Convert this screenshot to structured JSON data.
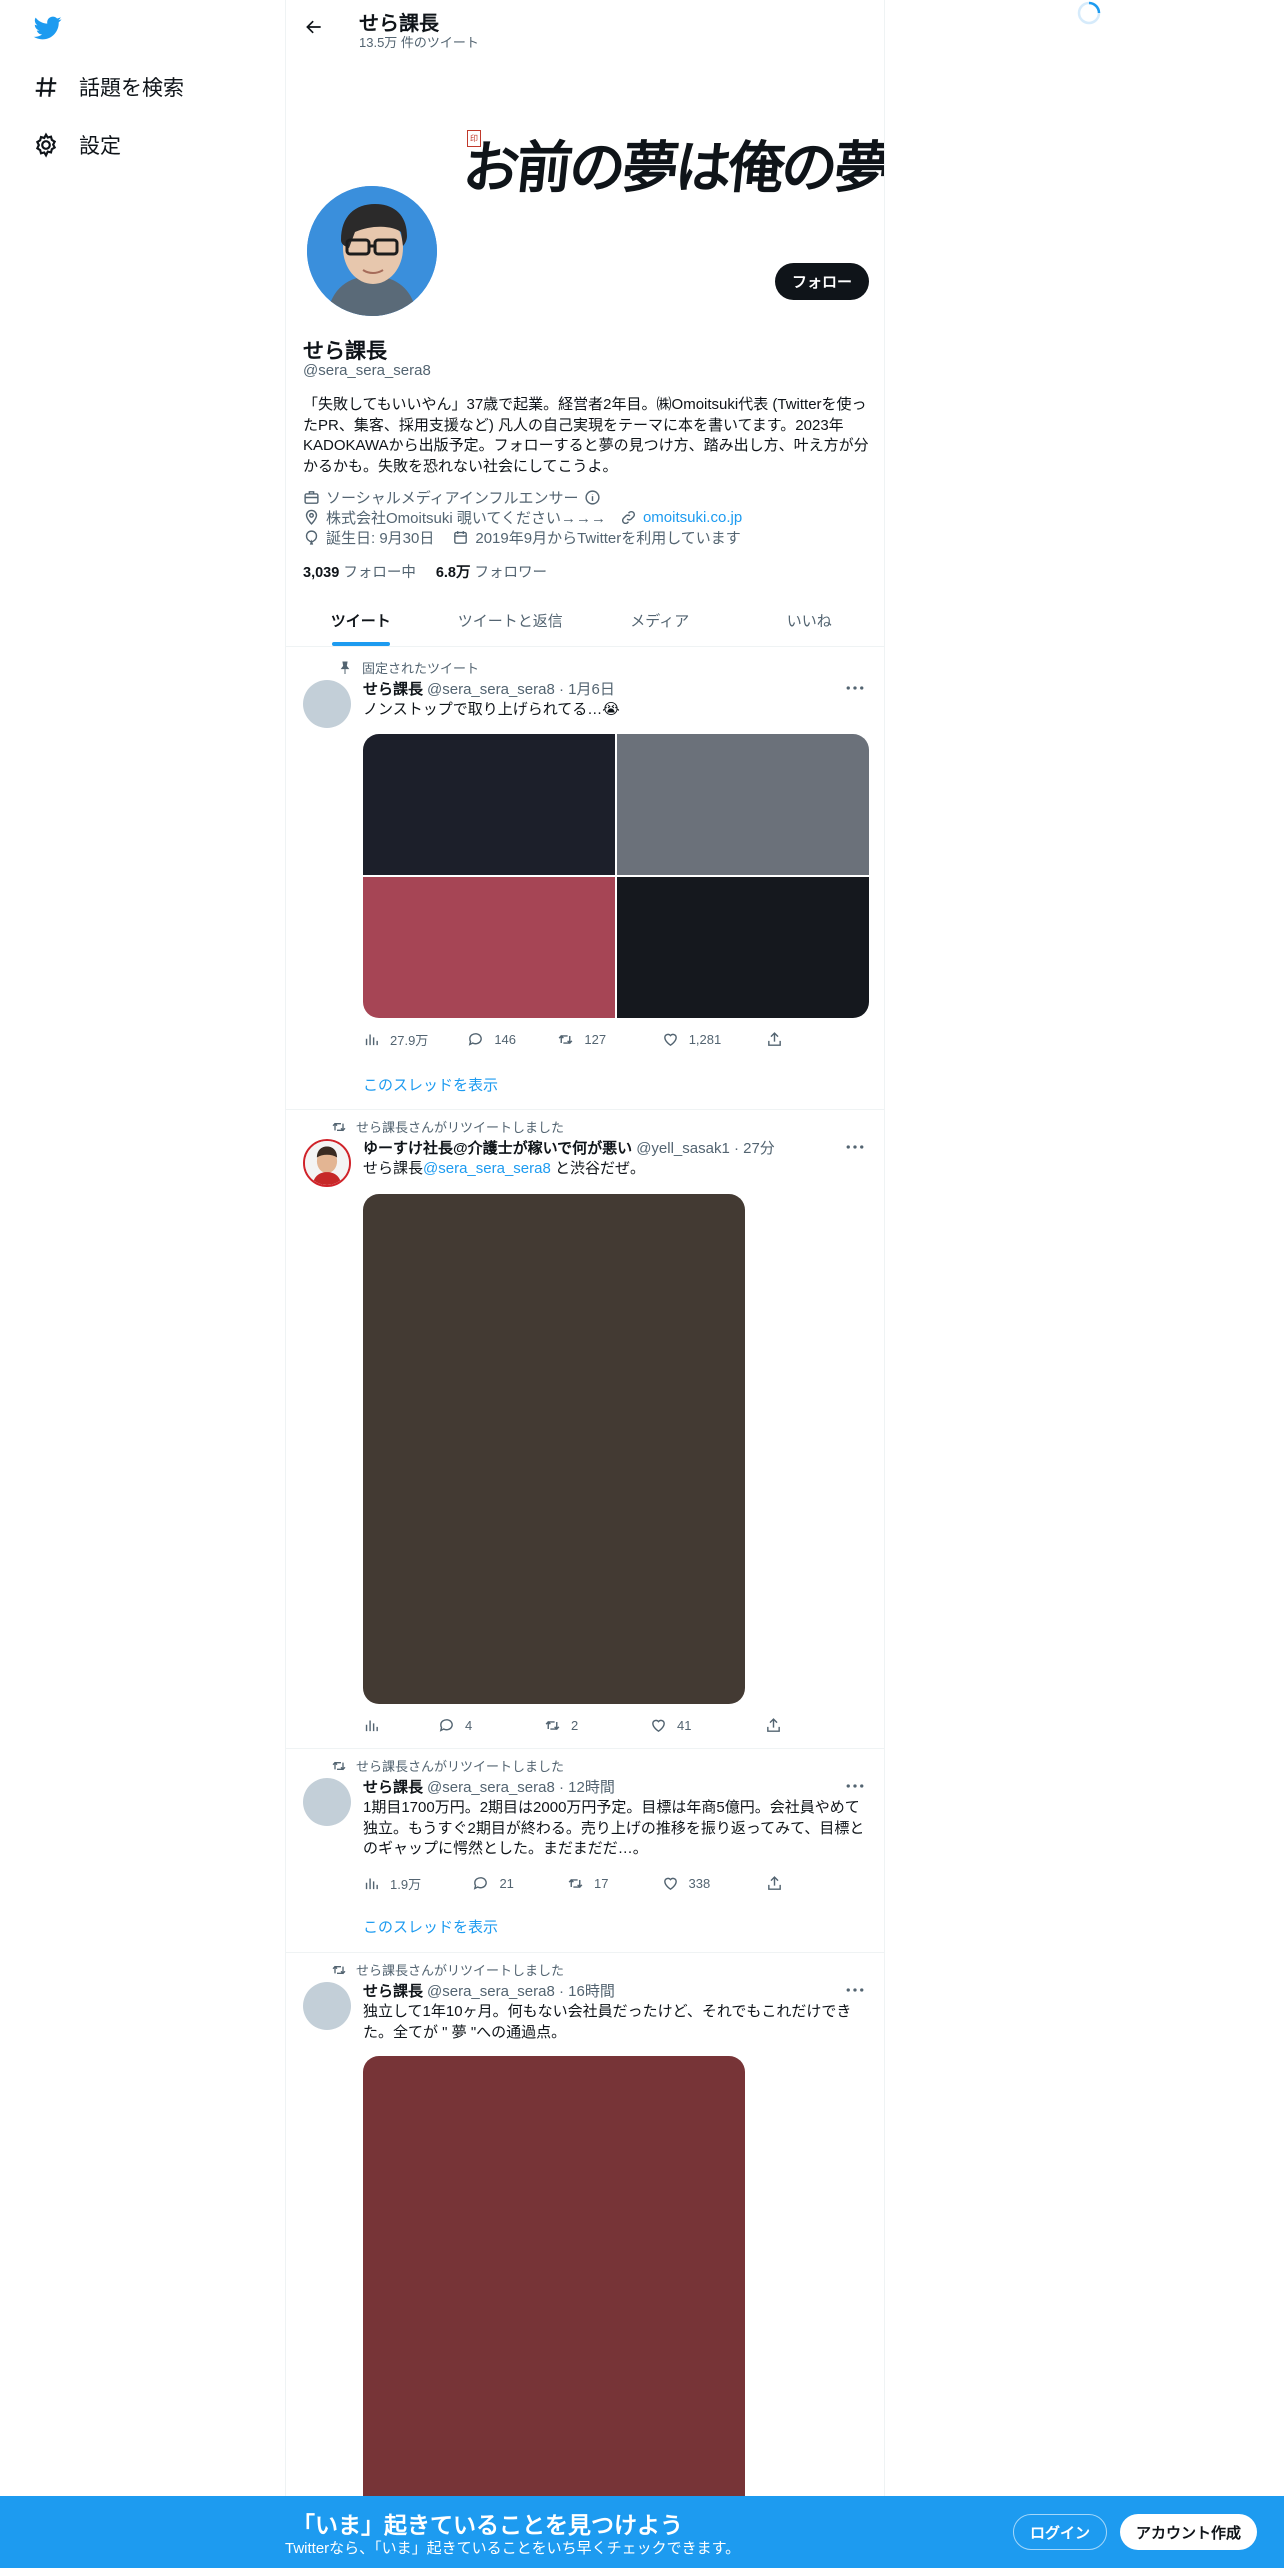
{
  "nav": {
    "explore_label": "話題を検索",
    "settings_label": "設定"
  },
  "header": {
    "title": "せら課長",
    "tweet_count": "13.5万 件のツイート"
  },
  "banner": {
    "calligraphy": "お前の夢は俺の夢"
  },
  "profile": {
    "follow_label": "フォロー",
    "name": "せら課長",
    "handle": "@sera_sera_sera8",
    "bio": "「失敗してもいいやん」37歳で起業。経営者2年目。㈱Omoitsuki代表 (Twitterを使ったPR、集客、採用支援など) 凡人の自己実現をテーマに本を書いてます。2023年KADOKAWAから出版予定。フォローすると夢の見つけ方、踏み出し方、叶え方が分かるかも。失敗を恐れない社会にしてこうよ。",
    "category": "ソーシャルメディアインフルエンサー",
    "location": "株式会社Omoitsuki 覗いてください→→→",
    "website": "omoitsuki.co.jp",
    "birthday": "誕生日: 9月30日",
    "joined": "2019年9月からTwitterを利用しています",
    "following_count": "3,039",
    "following_label": "フォロー中",
    "followers_count": "6.8万",
    "followers_label": "フォロワー"
  },
  "tabs": [
    "ツイート",
    "ツイートと返信",
    "メディア",
    "いいね"
  ],
  "tweets": [
    {
      "social": "固定されたツイート",
      "name": "せら課長",
      "handle_time": "@sera_sera_sera8 · 1月6日",
      "text": "ノンストップで取り上げられてる…😭",
      "views": "27.9万",
      "replies": "146",
      "retweets": "127",
      "likes": "1,281",
      "thread_link": "このスレッドを表示"
    },
    {
      "social": "せら課長さんがリツイートしました",
      "name": "ゆーすけ社長@介護士が稼いで何が悪い",
      "handle_time": "@yell_sasak1 · 27分",
      "text_prefix": "せら課長",
      "mention": "@sera_sera_sera8",
      "text_suffix": " と渋谷だぜ。",
      "replies": "4",
      "retweets": "2",
      "likes": "41"
    },
    {
      "social": "せら課長さんがリツイートしました",
      "name": "せら課長",
      "handle_time": "@sera_sera_sera8 · 12時間",
      "text": "1期目1700万円。2期目は2000万円予定。目標は年商5億円。会社員やめて独立。もうすぐ2期目が終わる。売り上げの推移を振り返ってみて、目標とのギャップに愕然とした。まだまだだ…。",
      "views": "1.9万",
      "replies": "21",
      "retweets": "17",
      "likes": "338",
      "thread_link": "このスレッドを表示"
    },
    {
      "social": "せら課長さんがリツイートしました",
      "name": "せら課長",
      "handle_time": "@sera_sera_sera8 · 16時間",
      "text": "独立して1年10ヶ月。何もない会社員だったけど、それでもこれだけできた。全てが \" 夢 \"への通過点。"
    }
  ],
  "bottom_bar": {
    "title": "「いま」起きていることを見つけよう",
    "subtitle": "Twitterなら、「いま」起きていることをいち早くチェックできます。",
    "login_label": "ログイン",
    "signup_label": "アカウント作成"
  },
  "colors": {
    "brand": "#1d9bf0",
    "text": "#0f1419",
    "muted": "#536471",
    "media1": "#1c1f2a",
    "media2": "#6b717a",
    "media3": "#a64555",
    "media4": "#15181e",
    "media5": "#433a33",
    "media6": "#773437"
  }
}
